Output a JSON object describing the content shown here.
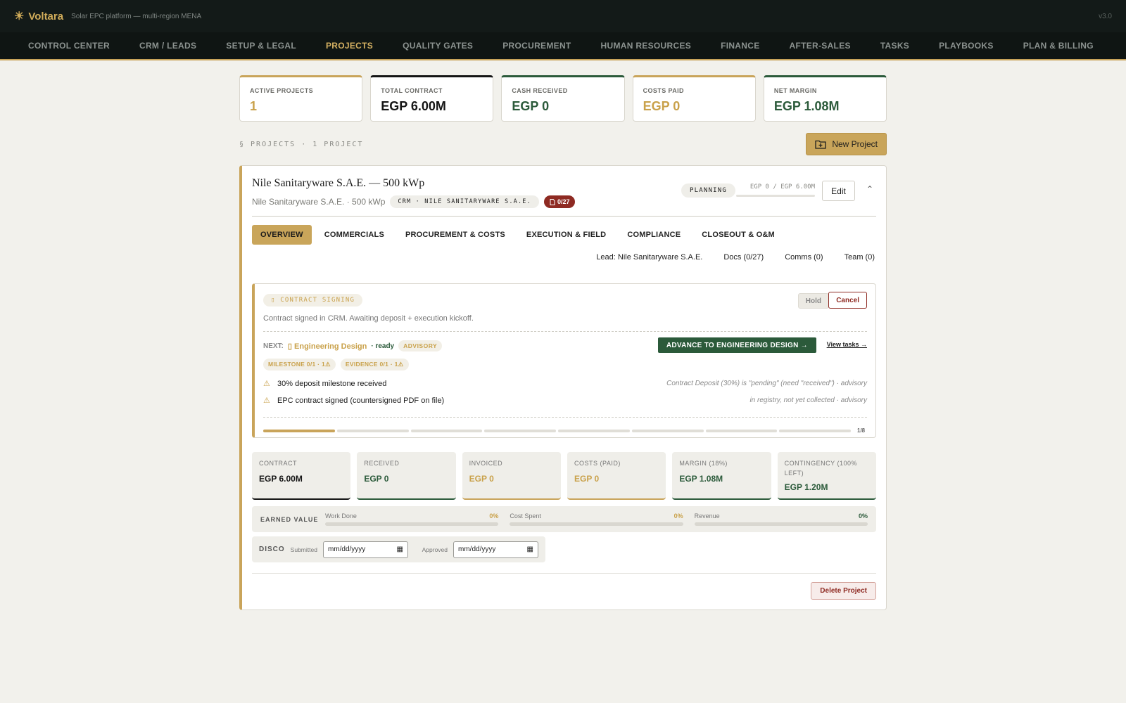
{
  "app": {
    "name": "Voltara",
    "tagline": "Solar EPC platform — multi-region MENA",
    "version": "v3.0"
  },
  "nav": [
    "CONTROL CENTER",
    "CRM / LEADS",
    "SETUP & LEGAL",
    "PROJECTS",
    "QUALITY GATES",
    "PROCUREMENT",
    "HUMAN RESOURCES",
    "FINANCE",
    "AFTER-SALES",
    "TASKS",
    "PLAYBOOKS",
    "PLAN & BILLING"
  ],
  "kpis": [
    {
      "label": "ACTIVE PROJECTS",
      "value": "1"
    },
    {
      "label": "TOTAL CONTRACT",
      "value": "EGP 6.00M"
    },
    {
      "label": "CASH RECEIVED",
      "value": "EGP 0"
    },
    {
      "label": "COSTS PAID",
      "value": "EGP 0"
    },
    {
      "label": "NET MARGIN",
      "value": "EGP 1.08M"
    }
  ],
  "section": {
    "label": "§ PROJECTS · 1 PROJECT",
    "new_button": "New Project"
  },
  "project": {
    "title": "Nile Sanitaryware S.A.E. — 500 kWp",
    "subtitle": "Nile Sanitaryware S.A.E. · 500 kWp",
    "crm_chip": "CRM · NILE SANITARYWARE S.A.E.",
    "docs_chip": "0/27",
    "status": "PLANNING",
    "cash_mini": "EGP 0 / EGP 6.00M",
    "edit": "Edit"
  },
  "tabs": [
    "OVERVIEW",
    "COMMERCIALS",
    "PROCUREMENT & COSTS",
    "EXECUTION & FIELD",
    "COMPLIANCE",
    "CLOSEOUT & O&M"
  ],
  "meta_links": [
    "Lead: Nile Sanitaryware S.A.E.",
    "Docs (0/27)",
    "Comms (0)",
    "Team (0)"
  ],
  "stage": {
    "name": "CONTRACT SIGNING",
    "hold": "Hold",
    "cancel": "Cancel",
    "description": "Contract signed in CRM. Awaiting deposit + execution kickoff.",
    "next_label": "NEXT:",
    "next_name": "Engineering Design",
    "ready": "· ready",
    "advisory": "ADVISORY",
    "advance": "ADVANCE TO ENGINEERING DESIGN →",
    "view_tasks": "View tasks →",
    "pills": [
      "MILESTONE 0/1 · 1⚠",
      "EVIDENCE 0/1 · 1⚠"
    ],
    "requirements": [
      {
        "text": "30% deposit milestone received",
        "note": "Contract Deposit (30%) is \"pending\" (need \"received\") · advisory"
      },
      {
        "text": "EPC contract signed (countersigned PDF on file)",
        "note": "in registry, not yet collected · advisory"
      }
    ],
    "progress_done": 1,
    "progress_total": 8,
    "progress_label": "1/8"
  },
  "fin": [
    {
      "label": "CONTRACT",
      "value": "EGP 6.00M"
    },
    {
      "label": "RECEIVED",
      "value": "EGP 0"
    },
    {
      "label": "INVOICED",
      "value": "EGP 0"
    },
    {
      "label": "COSTS (PAID)",
      "value": "EGP 0"
    },
    {
      "label": "MARGIN (18%)",
      "value": "EGP 1.08M"
    },
    {
      "label": "CONTINGENCY (100% LEFT)",
      "value": "EGP 1.20M"
    }
  ],
  "earned_value": {
    "label": "EARNED VALUE",
    "items": [
      {
        "name": "Work Done",
        "pct": "0%"
      },
      {
        "name": "Cost Spent",
        "pct": "0%"
      },
      {
        "name": "Revenue",
        "pct": "0%"
      }
    ]
  },
  "disco": {
    "label": "DISCO",
    "submitted": "Submitted",
    "approved": "Approved",
    "placeholder": "mm/dd/yyyy"
  },
  "delete": "Delete Project",
  "colors": {
    "gold": "#c9a45a",
    "green": "#2b5a3a",
    "dark": "#151515",
    "red": "#8e2a22"
  }
}
